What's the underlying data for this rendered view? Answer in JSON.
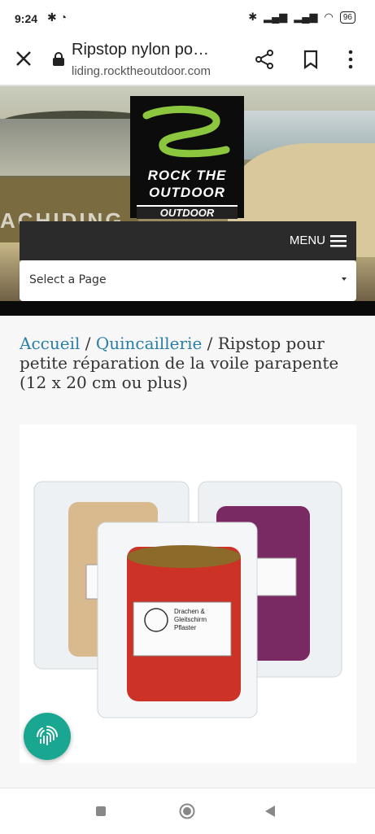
{
  "status": {
    "time": "9:24",
    "battery": "96"
  },
  "browser": {
    "title": "Ripstop nylon po…",
    "domain": "liding.rocktheoutdoor.com"
  },
  "site": {
    "logo_line1": "ROCK THE",
    "logo_line2": "OUTDOOR",
    "logo_line3": "OUTDOOR",
    "banner_text": "ACHIDING",
    "menu_label": "MENU",
    "select_value": "Select a Page"
  },
  "breadcrumb": {
    "home": "Accueil",
    "sep1": " / ",
    "category": "Quincaillerie",
    "sep2": " / ",
    "current": "Ripstop pour petite réparation de la voile parapente (12 x 20 cm ou plus)"
  },
  "product": {
    "pouch_label": "Drachen & Gleitschirm Pflaster",
    "colors": {
      "beige": "#d9b98e",
      "red": "#cc3226",
      "purple": "#7a2a62"
    }
  },
  "colors": {
    "link": "#2a7fa6",
    "fab": "#1aa791",
    "menubar": "#2b2b2b",
    "logo_green": "#8cc63f"
  }
}
